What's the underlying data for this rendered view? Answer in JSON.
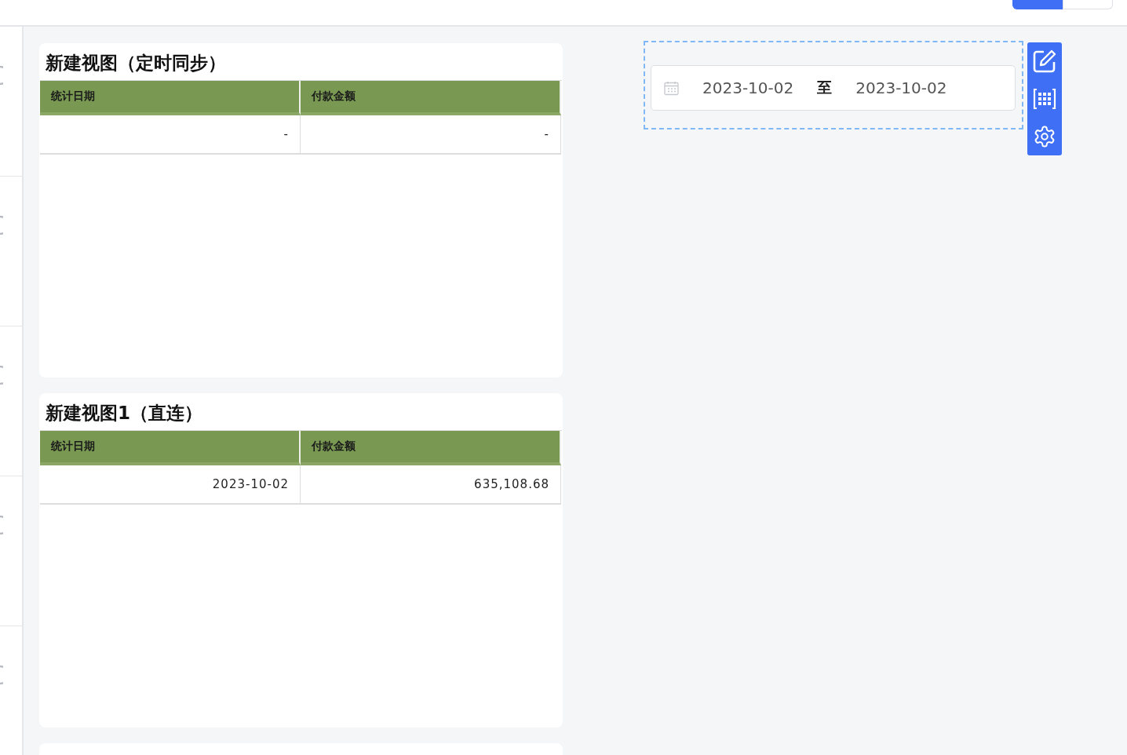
{
  "top_bar": {
    "toggle_segments": [
      {
        "selected": true
      },
      {
        "selected": false
      }
    ]
  },
  "cards": [
    {
      "kind": "table",
      "title": "新建视图（定时同步）",
      "columns": [
        "统计日期",
        "付款金额"
      ],
      "rows": [
        [
          "-",
          "-"
        ]
      ]
    },
    {
      "kind": "table",
      "title": "新建视图1（直连）",
      "columns": [
        "统计日期",
        "付款金额"
      ],
      "rows": [
        [
          "2023-10-02",
          "635,108.68"
        ]
      ]
    },
    {
      "kind": "blank"
    }
  ],
  "date_range": {
    "start": "2023-10-02",
    "separator": "至",
    "end": "2023-10-02"
  }
}
